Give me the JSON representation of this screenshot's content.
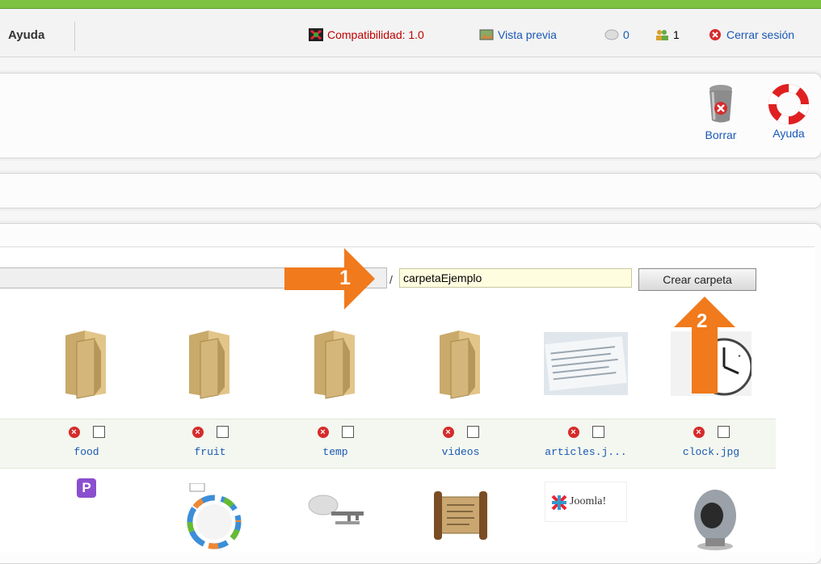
{
  "header": {
    "menu_label": "Ayuda",
    "compat": "Compatibilidad: 1.0",
    "preview": "Vista previa",
    "messages": "0",
    "users": "1",
    "logout": "Cerrar sesión"
  },
  "toolbar": {
    "delete_label": "Borrar",
    "help_label": "Ayuda"
  },
  "media": {
    "folder_name_value": "carpetaEjemplo",
    "create_button_label": "Crear carpeta",
    "callout_1": "1",
    "callout_2": "2",
    "row1": [
      {
        "name": "food",
        "kind": "folder"
      },
      {
        "name": "fruit",
        "kind": "folder"
      },
      {
        "name": "temp",
        "kind": "folder"
      },
      {
        "name": "videos",
        "kind": "folder"
      },
      {
        "name": "articles.j...",
        "kind": "image"
      },
      {
        "name": "clock.jpg",
        "kind": "image"
      }
    ],
    "row2_icons": [
      "p-badge-icon",
      "diagram-thumbnail",
      "keys-thumbnail",
      "scroll-thumbnail",
      "joomla-logo-thumbnail",
      "computer-thumbnail"
    ],
    "joomla_thumb_text": "Joomla!"
  },
  "colors": {
    "accent_green": "#7ec242",
    "link_blue": "#1a58b6",
    "alert_red": "#c00000",
    "arrow_orange": "#f07a1c"
  }
}
